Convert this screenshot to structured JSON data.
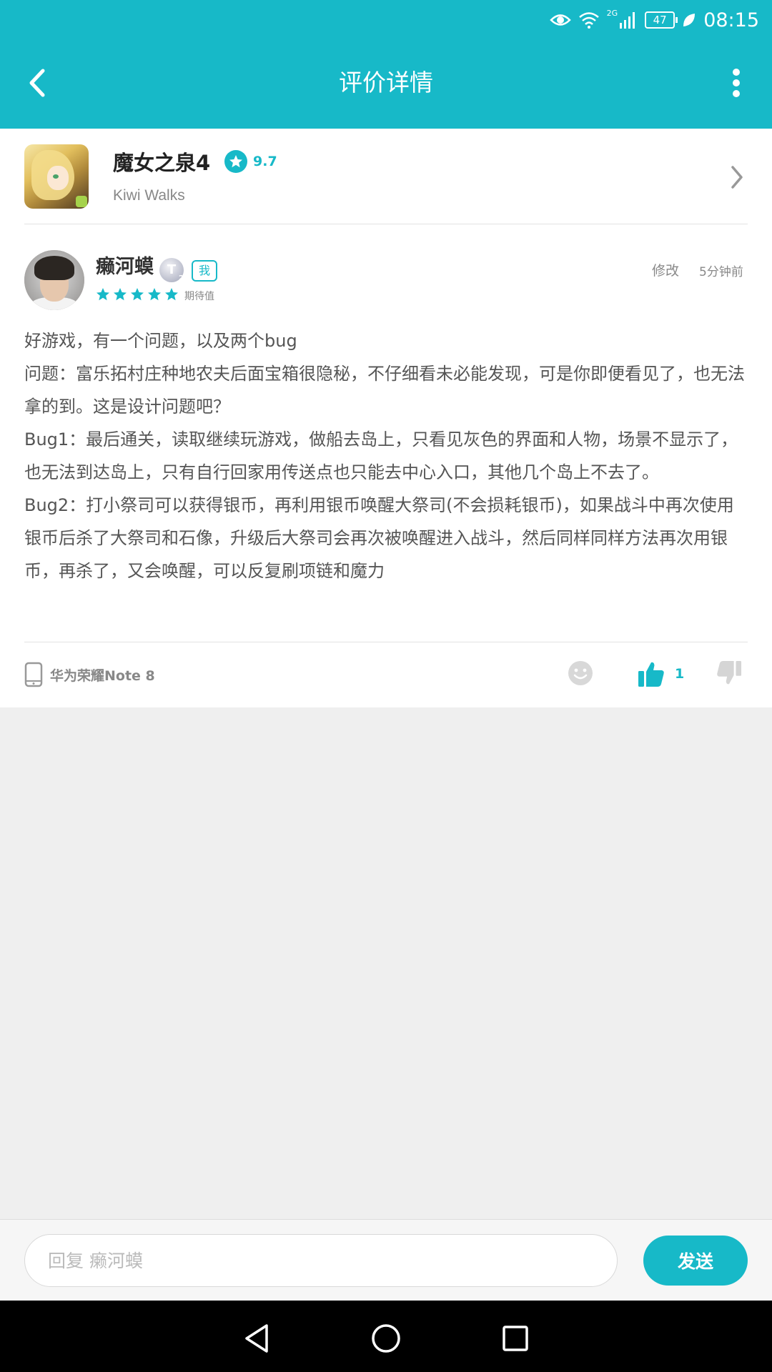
{
  "status_bar": {
    "network": "2G",
    "battery": "47",
    "time": "08:15"
  },
  "app_bar": {
    "title": "评价详情",
    "back_icon": "chevron-left-icon",
    "more_icon": "more-vertical-icon"
  },
  "game": {
    "name": "魔女之泉4",
    "rating": "9.7",
    "developer": "Kiwi Walks"
  },
  "review": {
    "user_name": "癞河蟆",
    "level_badge": "T",
    "level_sub": "2",
    "me_tag": "我",
    "stars": 5,
    "stars_label": "期待值",
    "edit_label": "修改",
    "time": "5分钟前",
    "paragraphs": [
      "好游戏，有一个问题，以及两个bug",
      "问题：富乐拓村庄种地农夫后面宝箱很隐秘，不仔细看未必能发现，可是你即便看见了，也无法拿的到。这是设计问题吧？",
      "Bug1：最后通关，读取继续玩游戏，做船去岛上，只看见灰色的界面和人物，场景不显示了，也无法到达岛上，只有自行回家用传送点也只能去中心入口，其他几个岛上不去了。",
      "Bug2：打小祭司可以获得银币，再利用银币唤醒大祭司(不会损耗银币)，如果战斗中再次使用银币后杀了大祭司和石像，升级后大祭司会再次被唤醒进入战斗，然后同样同样方法再次用银币，再杀了，又会唤醒，可以反复刷项链和魔力"
    ],
    "device": "华为荣耀Note 8",
    "like_count": "1"
  },
  "reply": {
    "placeholder": "回复 癞河蟆",
    "value": "",
    "send_label": "发送"
  },
  "colors": {
    "accent": "#17b9c8",
    "page_bg": "#efefef"
  }
}
